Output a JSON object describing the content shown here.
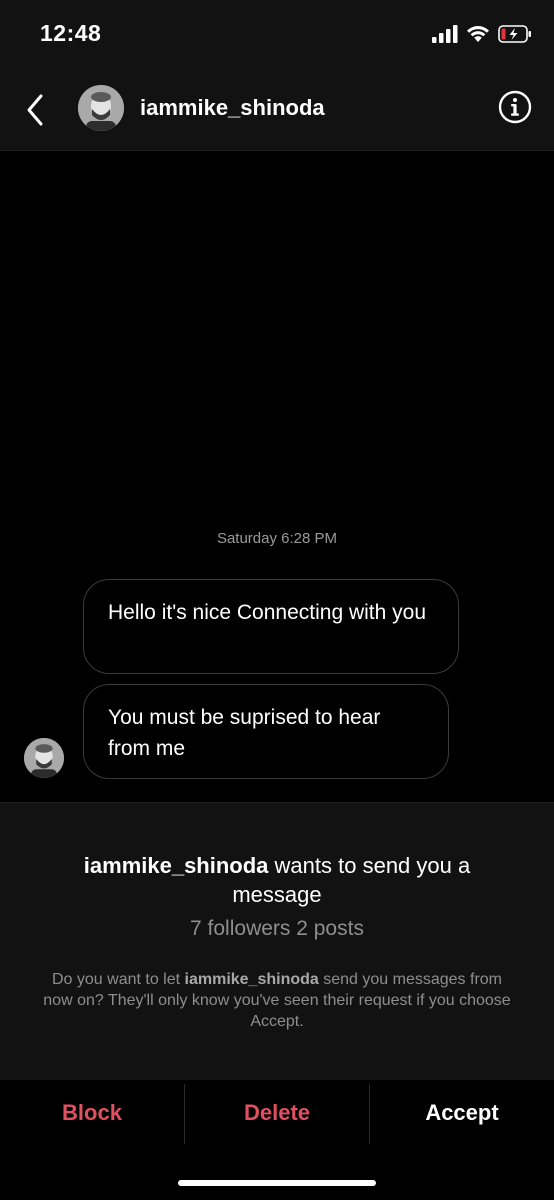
{
  "status_bar": {
    "time": "12:48",
    "icons": [
      "signal-icon",
      "wifi-icon",
      "battery-low-charging-icon"
    ]
  },
  "header": {
    "back_icon": "chevron-left-icon",
    "username": "iammike_shinoda",
    "info_icon": "info-icon"
  },
  "chat": {
    "timestamp": "Saturday 6:28 PM",
    "messages": [
      {
        "text": "Hello it's nice Connecting with you"
      },
      {
        "text": "You must be suprised to hear from me"
      }
    ]
  },
  "request": {
    "title_username": "iammike_shinoda",
    "title_rest": " wants to send you a message",
    "stats": "7 followers 2 posts",
    "desc_before": "Do you want to let ",
    "desc_username": "iammike_shinoda",
    "desc_after": " send you messages from now on? They'll only know you've seen their request if you choose Accept."
  },
  "actions": {
    "block_label": "Block",
    "delete_label": "Delete",
    "accept_label": "Accept"
  },
  "colors": {
    "background": "#000000",
    "panel": "#121212",
    "destructive": "#e0505f",
    "muted_text": "#8e8e8e",
    "battery_low": "#e0353f"
  }
}
